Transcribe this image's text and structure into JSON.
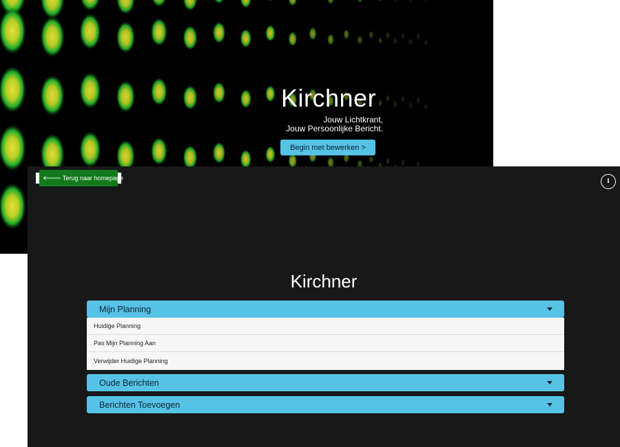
{
  "hero": {
    "title": "Kirchner",
    "subtitle_line1": "Jouw Lichtkrant,",
    "subtitle_line2": "Jouw Persoonlijke Bericht.",
    "cta_label": "Begin met bewerken >"
  },
  "panel": {
    "back_label": "Terug naar homepage",
    "info_label": "i",
    "title": "Kirchner",
    "accordions": [
      {
        "label": "Mijn Planning",
        "expanded": true,
        "items": [
          "Huidige Planning",
          "Pas Mijn Planning Aan",
          "Verwijder Huidige Planning"
        ]
      },
      {
        "label": "Oude Berichten",
        "expanded": false
      },
      {
        "label": "Berichten Toevoegen",
        "expanded": false
      }
    ]
  },
  "colors": {
    "accent": "#56c2e6",
    "panel_bg": "#181818",
    "back_button": "#137a1c",
    "led_green": "#1fae2a",
    "led_yellow": "#c8d62a"
  },
  "icons": {
    "back": "arrow-left-icon",
    "info": "info-icon",
    "caret": "chevron-down-icon"
  }
}
